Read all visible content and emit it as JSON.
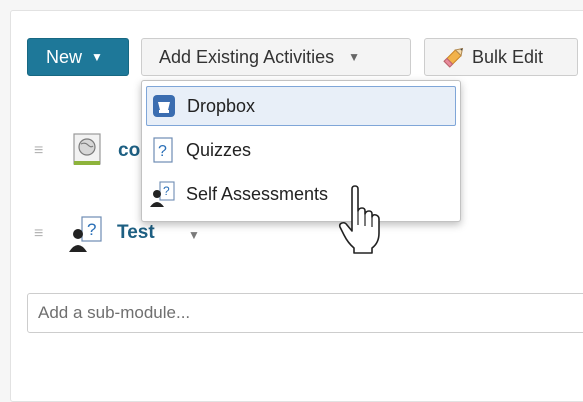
{
  "toolbar": {
    "new_label": "New",
    "add_existing_label": "Add Existing Activities",
    "bulk_edit_label": "Bulk Edit"
  },
  "dropdown": {
    "items": [
      {
        "label": "Dropbox",
        "icon": "dropbox-icon",
        "highlighted": true
      },
      {
        "label": "Quizzes",
        "icon": "quiz-icon",
        "highlighted": false
      },
      {
        "label": "Self Assessments",
        "icon": "self-assessment-icon",
        "highlighted": false
      }
    ]
  },
  "modules": [
    {
      "title": "co",
      "icon": "web-page-icon"
    },
    {
      "title": "Test",
      "icon": "self-assessment-icon"
    }
  ],
  "sub_module": {
    "placeholder": "Add a sub-module..."
  },
  "colors": {
    "primary": "#1e7899",
    "link": "#1d5f82",
    "highlight_bg": "#e8eff8",
    "highlight_border": "#7fa6d8"
  }
}
